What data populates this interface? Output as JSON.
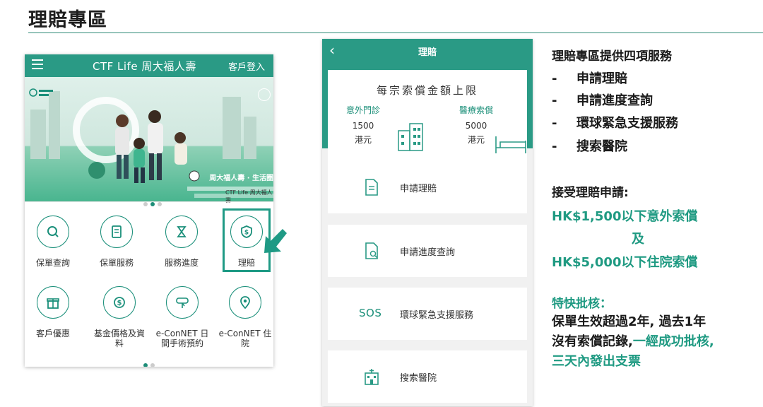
{
  "page": {
    "title": "理賠專區"
  },
  "home_app": {
    "header": {
      "brand": "CTF Life 周大福人壽",
      "login": "客戶登入"
    },
    "banner": {
      "caption_line1": "周大福人壽 · 生活圈",
      "brand_mark": "CTF Life 周大福人壽"
    },
    "tiles": [
      {
        "label": "保單查詢",
        "icon": "search-icon"
      },
      {
        "label": "保單服務",
        "icon": "policy-document-icon"
      },
      {
        "label": "服務進度",
        "icon": "hourglass-icon"
      },
      {
        "label": "理賠",
        "icon": "shield-dollar-icon"
      },
      {
        "label": "客戶優惠",
        "icon": "gift-icon"
      },
      {
        "label": "基金價格及資料",
        "icon": "dollar-coin-icon"
      },
      {
        "label": "e-ConNET 日間手術預約",
        "icon": "book-click-icon"
      },
      {
        "label": "e-ConNET 住院",
        "icon": "location-pin-icon"
      }
    ]
  },
  "claims_app": {
    "title": "理賠",
    "limit_card": {
      "title": "每宗索償金額上限",
      "outpatient": {
        "label": "意外門診",
        "amount": "1500",
        "unit": "港元"
      },
      "medical": {
        "label": "醫療索償",
        "amount": "5000",
        "unit": "港元"
      }
    },
    "services": [
      {
        "label": "申請理賠",
        "icon": "document-icon"
      },
      {
        "label": "申請進度查詢",
        "icon": "document-search-icon"
      },
      {
        "label": "環球緊急支援服務",
        "icon": "sos-icon",
        "badge": "SOS"
      },
      {
        "label": "搜索醫院",
        "icon": "hospital-icon"
      }
    ]
  },
  "info": {
    "services_heading": "理賠專區提供四項服務",
    "services": [
      "申請理賠",
      "申請進度查詢",
      "環球緊急支援服務",
      "搜索醫院"
    ],
    "bullet": "-",
    "accept_heading": "接受理賠申請:",
    "accept_line1": "HK$1,500以下意外索償",
    "accept_and": "及",
    "accept_line2": "HK$5,000以下住院索償",
    "fast_heading": "特快批核：",
    "fast_line1": "保單生效超過2年, 過去1年",
    "fast_line2_dark": "沒有索償記錄,",
    "fast_line2_green": "一經成功批核,",
    "fast_line3": "三天內發出支票"
  },
  "colors": {
    "brand": "#2a9a85",
    "accent_text": "#1f9a82"
  }
}
